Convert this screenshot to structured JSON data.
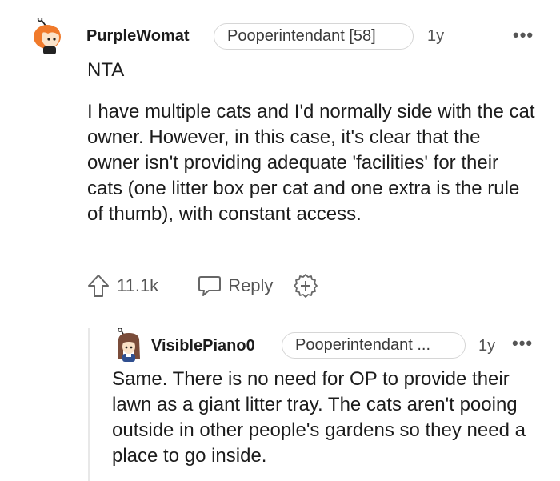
{
  "comments": [
    {
      "username": "PurpleWomat",
      "flair": "Pooperintendant [58]",
      "age": "1y",
      "more": "•••",
      "paragraphs": [
        "NTA",
        "I have multiple cats and I'd normally side with the cat owner. However, in this case, it's clear that the owner isn't providing adequate 'facilities' for their cats (one litter box per cat and one extra is the rule of thumb), with constant access."
      ],
      "votes": "11.1k",
      "reply_label": "Reply"
    },
    {
      "username": "VisiblePiano0",
      "flair": "Pooperintendant ...",
      "age": "1y",
      "more": "•••",
      "paragraphs": [
        "Same. There is no need for OP to provide their lawn as a giant litter tray. The cats aren't pooing outside in other people's gardens so they need a place to go inside."
      ]
    }
  ],
  "icons": {
    "upvote": "upvote-icon",
    "reply": "reply-icon",
    "award": "award-icon",
    "more": "more-options-icon"
  },
  "colors": {
    "text": "#1c1c1c",
    "muted": "#555555",
    "border": "#d6d6d6"
  }
}
